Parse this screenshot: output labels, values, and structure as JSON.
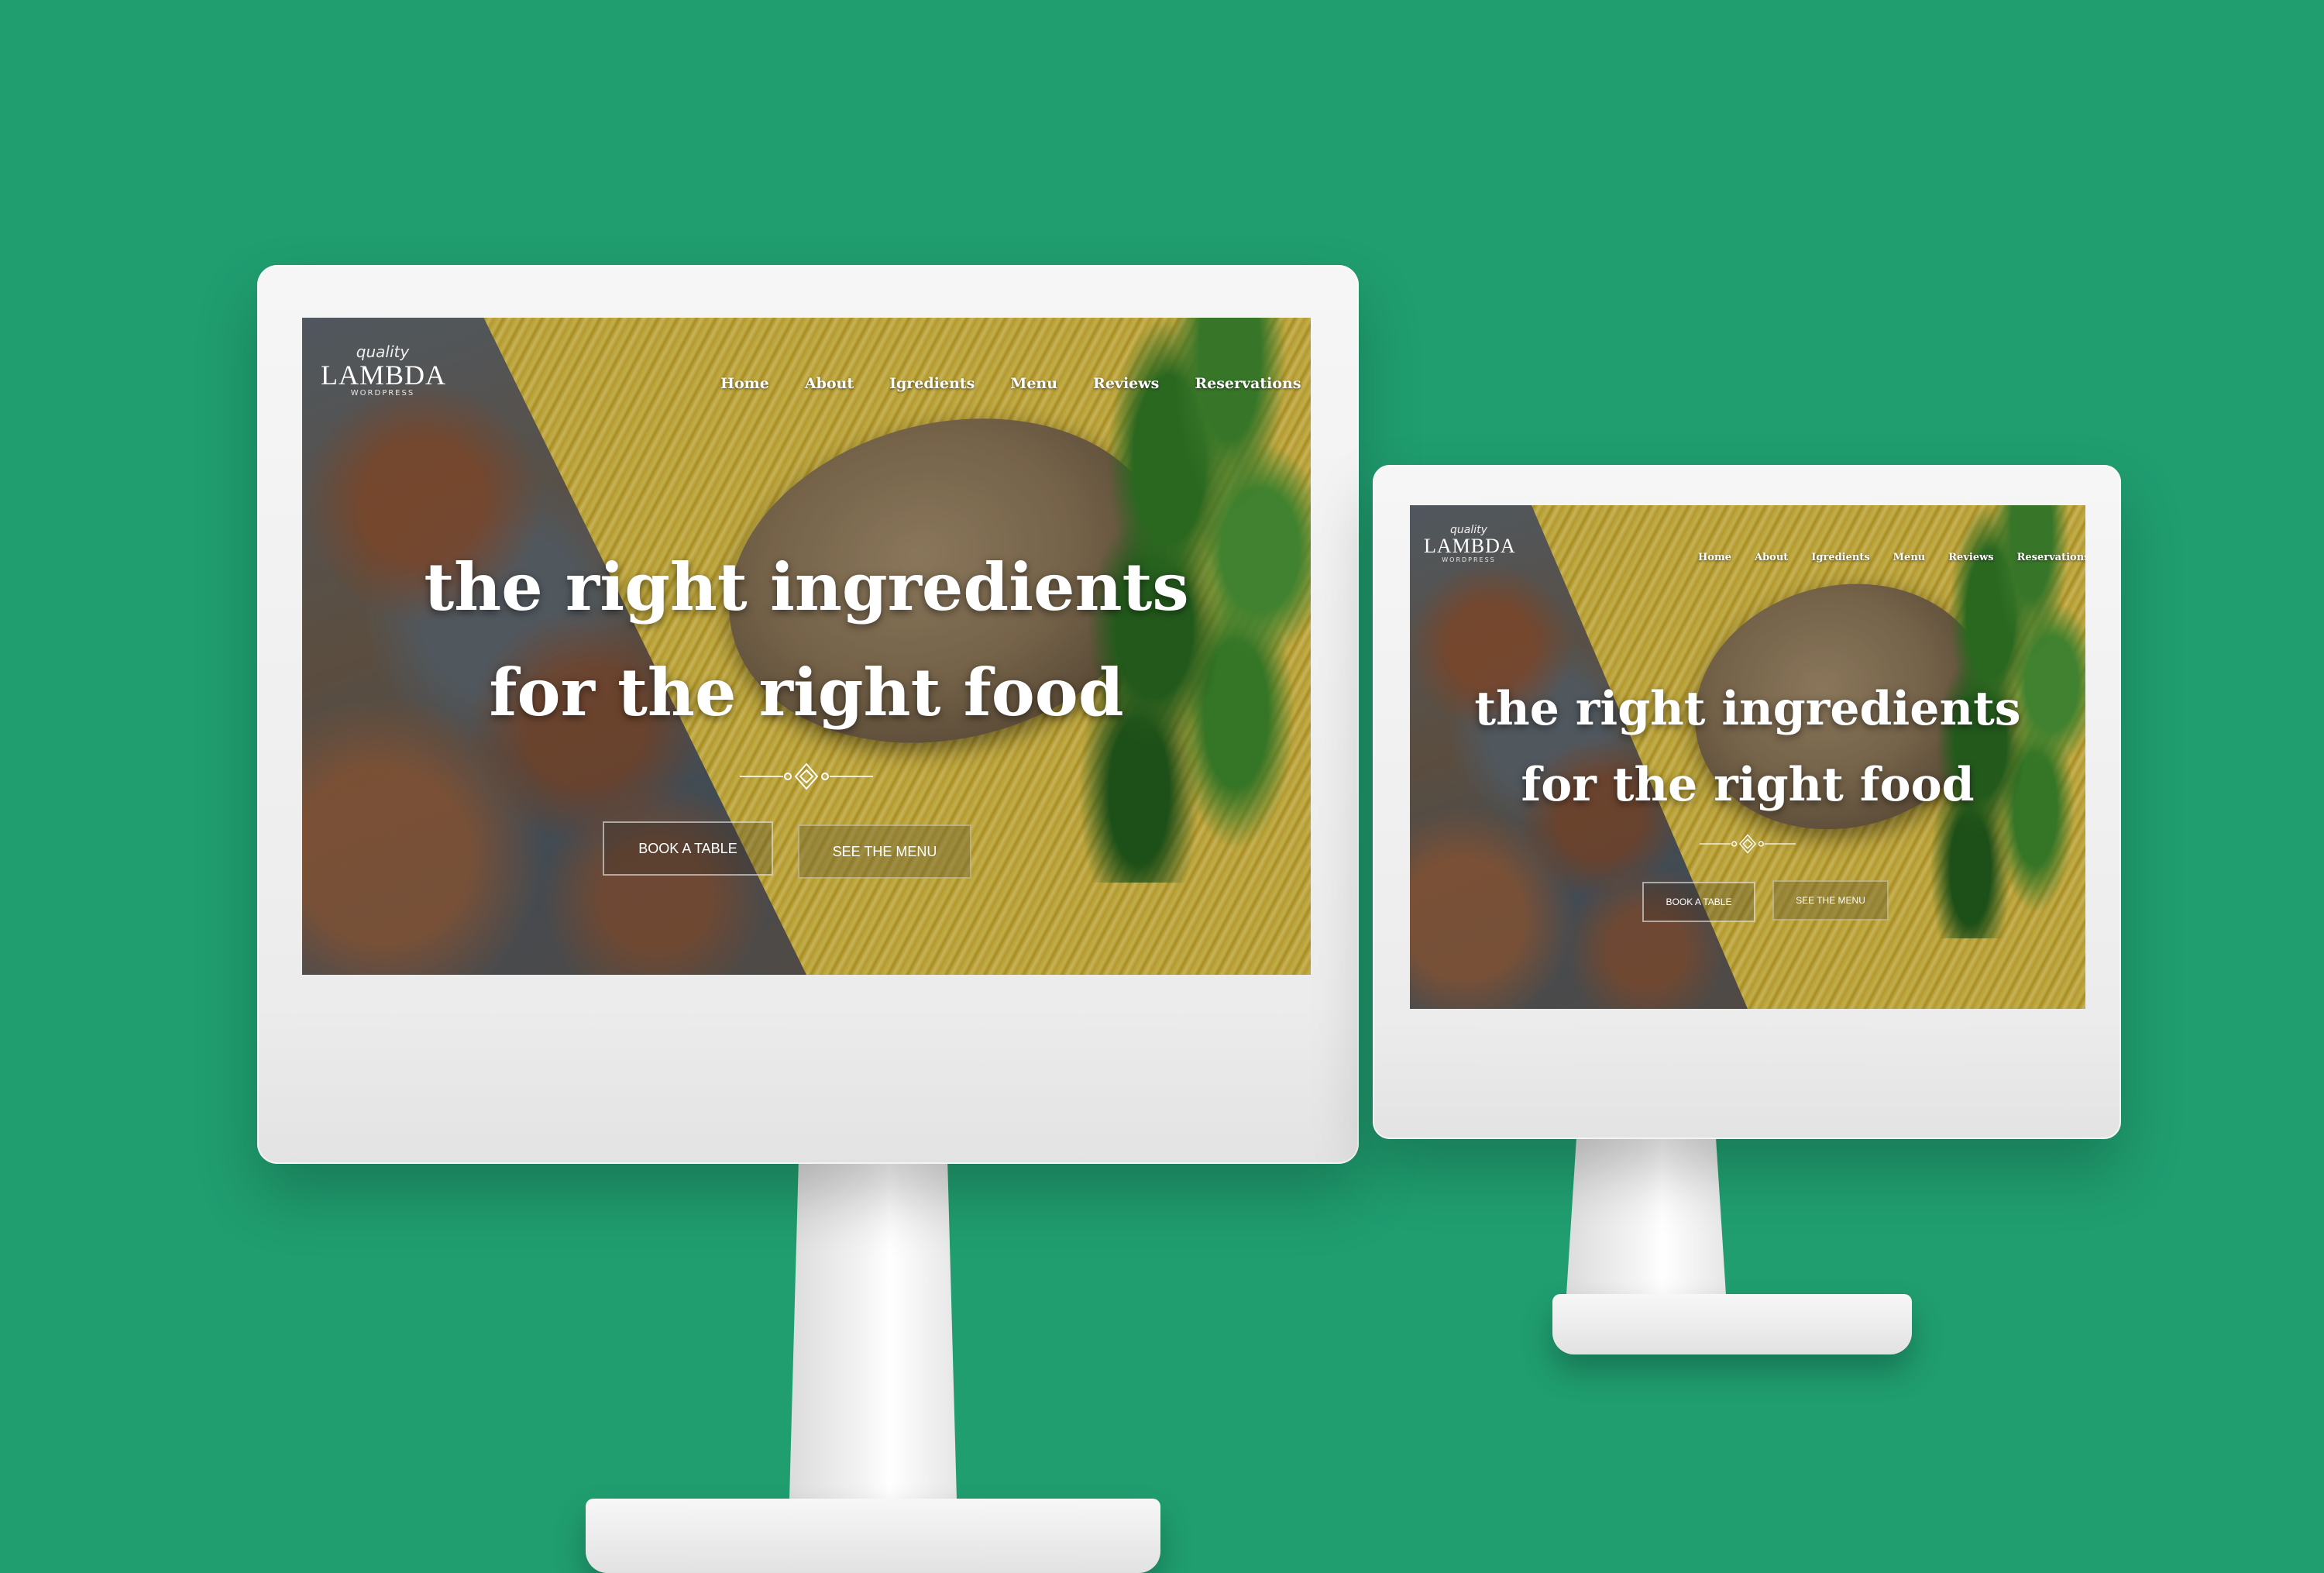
{
  "colors": {
    "background": "#209e70",
    "monitor": "#f0f0f0",
    "text": "#ffffff"
  },
  "site": {
    "logo": {
      "script": "quality",
      "main": "LAMBDA",
      "sub": "WORDPRESS"
    },
    "nav": {
      "home": "Home",
      "about": "About",
      "ingredients": "Igredients",
      "menu": "Menu",
      "reviews": "Reviews",
      "reservations": "Reservations"
    },
    "hero": {
      "line1": "the right ingredients",
      "line2": "for the right food"
    },
    "buttons": {
      "book": "BOOK A TABLE",
      "menu": "SEE THE MENU"
    },
    "ornament_icon": "ornamental-divider-icon"
  }
}
